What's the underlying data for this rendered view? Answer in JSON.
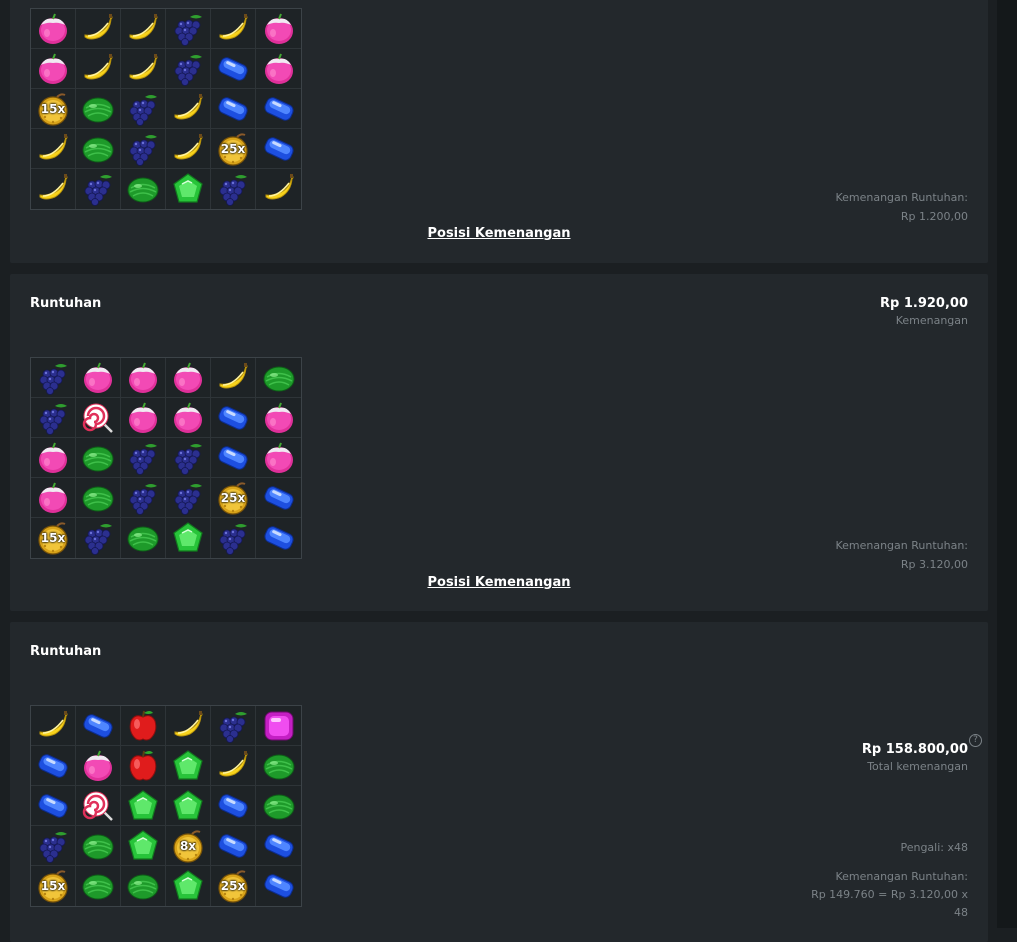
{
  "panels": [
    {
      "title": "",
      "win_amount": "",
      "win_label": "",
      "grid": [
        [
          "plum",
          "banana",
          "banana",
          "grape",
          "banana",
          "plum"
        ],
        [
          "plum",
          "banana",
          "banana",
          "grape",
          "blue",
          "plum"
        ],
        [
          "bomb",
          "melon",
          "grape",
          "banana",
          "blue",
          "blue"
        ],
        [
          "banana",
          "melon",
          "grape",
          "banana",
          "bomb",
          "blue"
        ],
        [
          "banana",
          "grape",
          "melon",
          "green",
          "grape",
          "banana"
        ]
      ],
      "multipliers": {
        "2-0": "15x",
        "3-4": "25x"
      },
      "cascade_label": "Kemenangan Runtuhan:",
      "cascade_value": "Rp 1.200,00",
      "link": "Posisi Kemenangan"
    },
    {
      "title": "Runtuhan",
      "win_amount": "Rp 1.920,00",
      "win_label": "Kemenangan",
      "grid": [
        [
          "grape",
          "plum",
          "plum",
          "plum",
          "banana",
          "melon"
        ],
        [
          "grape",
          "lolly",
          "plum",
          "plum",
          "blue",
          "plum"
        ],
        [
          "plum",
          "melon",
          "grape",
          "grape",
          "blue",
          "plum"
        ],
        [
          "plum",
          "melon",
          "grape",
          "grape",
          "bomb",
          "blue"
        ],
        [
          "bomb",
          "grape",
          "melon",
          "green",
          "grape",
          "blue"
        ]
      ],
      "multipliers": {
        "3-4": "25x",
        "4-0": "15x"
      },
      "cascade_label": "Kemenangan Runtuhan:",
      "cascade_value": "Rp 3.120,00",
      "link": "Posisi Kemenangan"
    },
    {
      "title": "Runtuhan",
      "grid": [
        [
          "banana",
          "blue",
          "apple",
          "banana",
          "grape",
          "purple"
        ],
        [
          "blue",
          "plum",
          "apple",
          "green",
          "banana",
          "melon"
        ],
        [
          "blue",
          "lolly",
          "green",
          "green",
          "blue",
          "melon"
        ],
        [
          "grape",
          "melon",
          "green",
          "bomb",
          "blue",
          "blue"
        ],
        [
          "bomb",
          "melon",
          "melon",
          "green",
          "bomb",
          "blue"
        ]
      ],
      "multipliers": {
        "3-3": "8x",
        "4-0": "15x",
        "4-4": "25x"
      },
      "total_amount": "Rp 158.800,00",
      "total_label": "Total kemenangan",
      "help": "?",
      "multiplier_label": "Pengali: x48",
      "cascade_label": "Kemenangan Runtuhan:",
      "cascade_formula": "Rp 149.760 = Rp 3.120,00 x",
      "cascade_formula_tail": "48"
    }
  ],
  "colors": {
    "background": "#1b1f22",
    "panel": "#23282c",
    "muted_text": "#7b8287"
  }
}
